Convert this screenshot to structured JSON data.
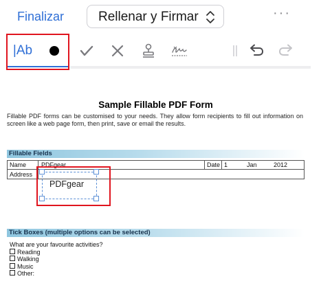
{
  "header": {
    "finalize_label": "Finalizar",
    "mode_selector": "Rellenar y Firmar",
    "more_label": "···"
  },
  "toolbar": {
    "text_tool_label": "|Ab",
    "tools": [
      "text-tool",
      "fill-dot",
      "checkmark",
      "cross",
      "stamp",
      "signature",
      "divider",
      "undo",
      "redo"
    ]
  },
  "document": {
    "title": "Sample Fillable PDF Form",
    "description": "Fillable PDF forms can be customised to your needs. They allow form recipients to fill out information on screen like a web page form, then print, save or email the results.",
    "fillable_section": {
      "heading": "Fillable Fields",
      "name_label": "Name",
      "name_value": "PDFgear",
      "date_label": "Date",
      "date_day": "1",
      "date_month": "Jan",
      "date_year": "2012",
      "address_label": "Address",
      "inserted_text": "PDFgear"
    },
    "tick_section": {
      "heading": "Tick Boxes (multiple options can be selected)",
      "question": "What are your favourite activities?",
      "options": [
        "Reading",
        "Walking",
        "Music",
        "Other:"
      ]
    }
  },
  "colors": {
    "accent": "#2f6fd6",
    "highlight_box": "#e0141e",
    "section_band": "#8fc6df",
    "selection": "#5b8fd6"
  }
}
